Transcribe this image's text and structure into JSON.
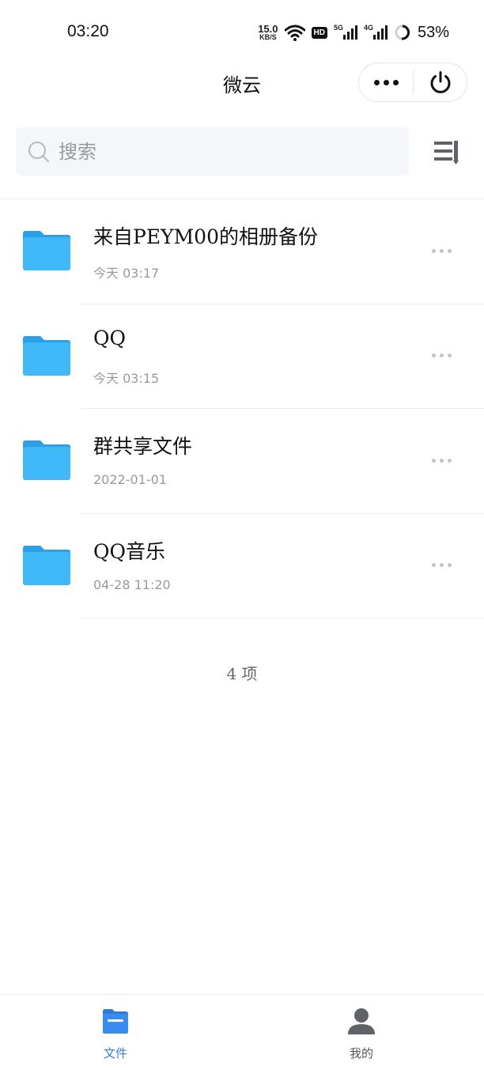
{
  "status_bar": {
    "time": "03:20",
    "speed_value": "15.0",
    "speed_unit": "KB/S",
    "hd_badge": "HD",
    "net1": "5G",
    "net2": "4G",
    "battery": "53%"
  },
  "header": {
    "title": "微云"
  },
  "search": {
    "placeholder": "搜索"
  },
  "files": [
    {
      "name": "来自PEYM00的相册备份",
      "time": "今天 03:17"
    },
    {
      "name": "QQ",
      "time": "今天 03:15"
    },
    {
      "name": "群共享文件",
      "time": "2022-01-01"
    },
    {
      "name": "QQ音乐",
      "time": "04-28 11:20"
    }
  ],
  "count_text": "4 项",
  "tabbar": {
    "files_label": "文件",
    "me_label": "我的"
  },
  "colors": {
    "folder": "#41b8f7",
    "folder_tab": "#2d9fe6",
    "accent": "#3a7fd5",
    "search_bg": "#f5f6f9"
  }
}
